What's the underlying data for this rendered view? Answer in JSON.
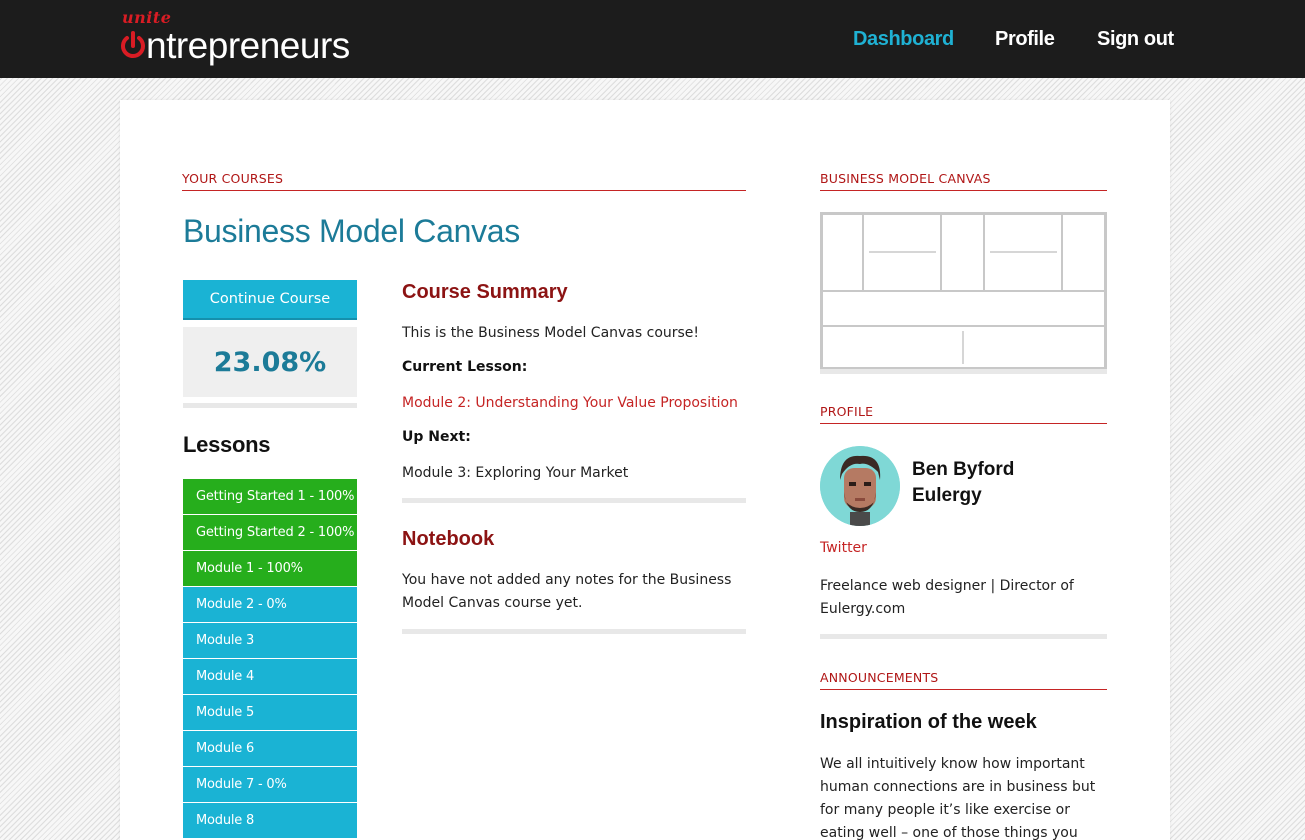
{
  "header": {
    "logo_small": "unite",
    "logo_word": "ntrepreneurs",
    "nav": {
      "dashboard": "Dashboard",
      "profile": "Profile",
      "signout": "Sign out"
    }
  },
  "courses": {
    "section_label": "YOUR COURSES",
    "title": "Business Model Canvas",
    "continue_label": "Continue Course",
    "progress_text": "23.08%",
    "progress_value": 23.08
  },
  "lessons": {
    "heading": "Lessons",
    "items": [
      {
        "label": "Getting Started 1 - 100%",
        "status": "done"
      },
      {
        "label": "Getting Started 2 - 100%",
        "status": "done"
      },
      {
        "label": "Module 1 - 100%",
        "status": "done"
      },
      {
        "label": "Module 2 - 0%",
        "status": "todo"
      },
      {
        "label": "Module 3",
        "status": "todo"
      },
      {
        "label": "Module 4",
        "status": "todo"
      },
      {
        "label": "Module 5",
        "status": "todo"
      },
      {
        "label": "Module 6",
        "status": "todo"
      },
      {
        "label": "Module 7 - 0%",
        "status": "todo"
      },
      {
        "label": "Module 8",
        "status": "todo"
      }
    ]
  },
  "summary": {
    "heading": "Course Summary",
    "intro": "This is the Business Model Canvas course!",
    "current_label": "Current Lesson:",
    "current_link": "Module 2: Understanding Your Value Proposition",
    "next_label": "Up Next:",
    "next_text": "Module 3: Exploring Your Market"
  },
  "notebook": {
    "heading": "Notebook",
    "text": "You have not added any notes for the Business Model Canvas course yet."
  },
  "sidebar": {
    "canvas_label": "BUSINESS MODEL CANVAS",
    "profile_label": "PROFILE",
    "profile_name": "Ben Byford",
    "profile_company": "Eulergy",
    "twitter_link": "Twitter",
    "bio": "Freelance web designer | Director of Eulergy.com",
    "announcements_label": "ANNOUNCEMENTS",
    "announcement_title": "Inspiration of the week",
    "announcement_text": "We all intuitively know how important human connections are in business but for many people it’s like exercise or eating well – one of those things you keep"
  },
  "colors": {
    "accent_teal": "#1ab3d4",
    "done_green": "#26ae1c",
    "brand_red": "#c52424",
    "title_blue": "#1c7b98",
    "heading_maroon": "#8c1313"
  },
  "icons": {
    "logo_power": "power-icon"
  }
}
